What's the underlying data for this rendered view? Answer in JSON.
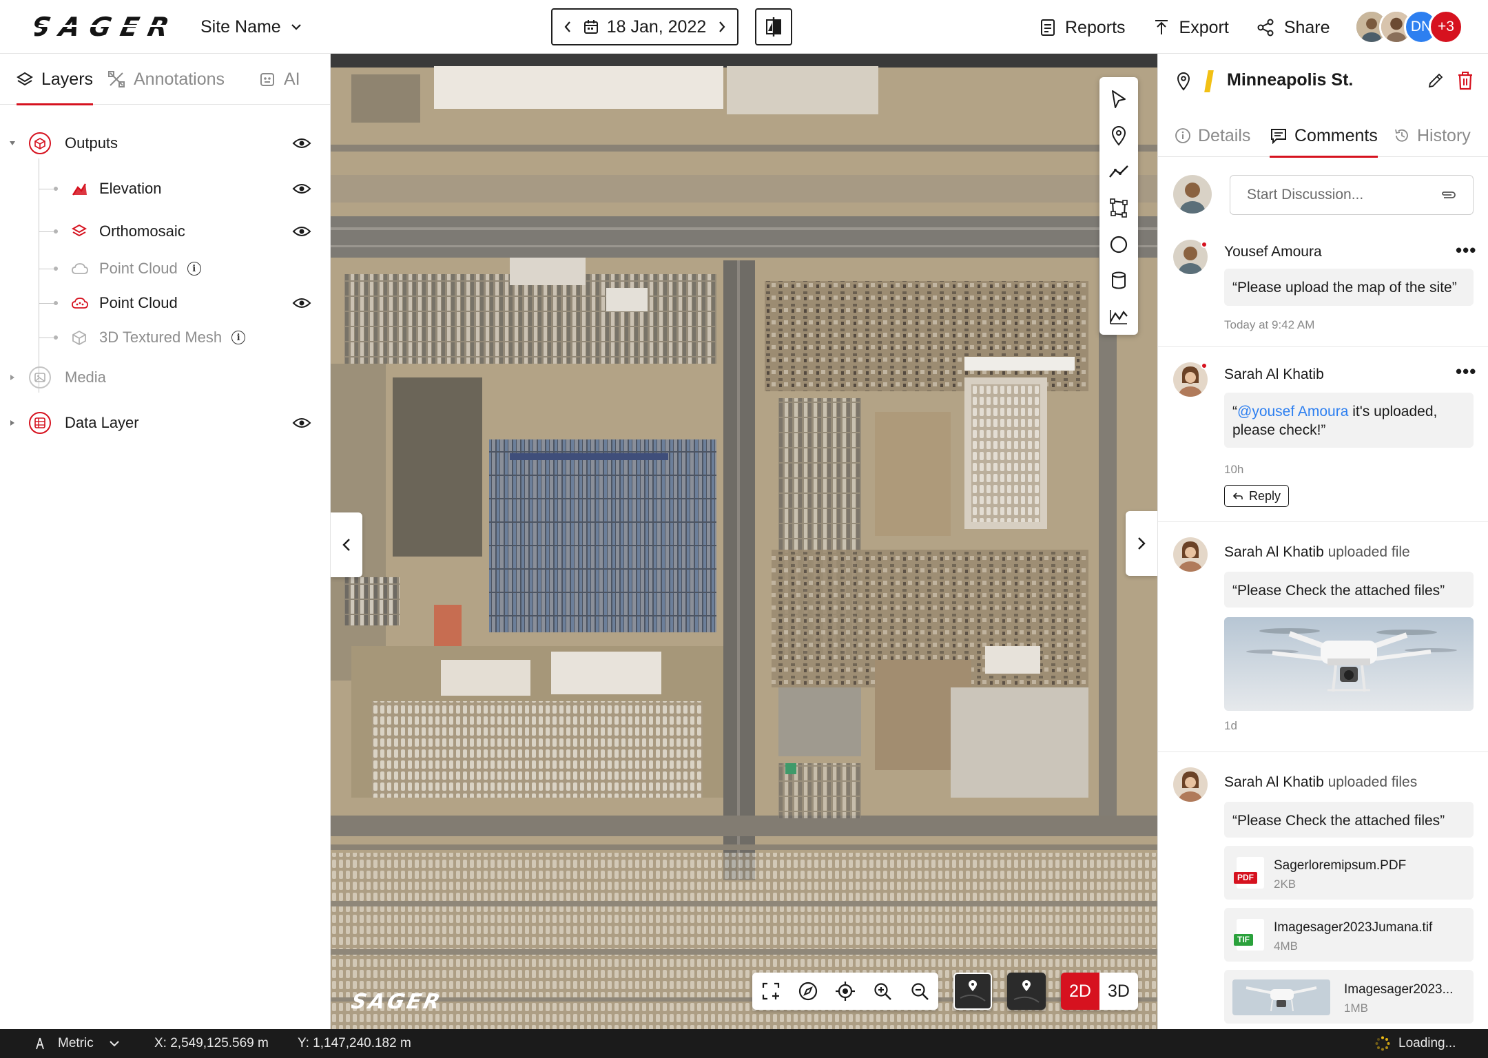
{
  "app": {
    "logo_text": "SAGER",
    "site_name": "Site Name"
  },
  "date": {
    "label": "18 Jan, 2022"
  },
  "actions": {
    "reports": "Reports",
    "export": "Export",
    "share": "Share"
  },
  "collaborators": {
    "initials": "DN",
    "more": "+3"
  },
  "left_tabs": {
    "layers": "Layers",
    "annotations": "Annotations",
    "ai": "AI"
  },
  "layers": {
    "outputs": "Outputs",
    "elevation": "Elevation",
    "orthomosaic": "Orthomosaic",
    "point_cloud_1": "Point Cloud",
    "point_cloud_2": "Point Cloud",
    "textured_mesh": "3D Textured Mesh",
    "media": "Media",
    "data_layer": "Data Layer"
  },
  "map": {
    "watermark": "SAGER",
    "view_2d": "2D",
    "view_3d": "3D",
    "active_view": "2D"
  },
  "detail": {
    "title": "Minneapolis St.",
    "tabs": {
      "details": "Details",
      "comments": "Comments",
      "history": "History"
    },
    "discussion_placeholder": "Start Discussion..."
  },
  "comments": [
    {
      "author": "Yousef Amoura",
      "action": "",
      "text": "“Please upload the map of the site”",
      "time": "Today at 9:42 AM"
    },
    {
      "author": "Sarah Al Khatib",
      "action": "",
      "mention": "@yousef Amoura",
      "text_pre": "“",
      "text_post": " it's uploaded,",
      "text_line2": "please check!”",
      "time": "10h",
      "reply": "Reply"
    },
    {
      "author": "Sarah Al Khatib",
      "action": "uploaded file",
      "text": "“Please Check the attached files”",
      "time": "1d"
    },
    {
      "author": "Sarah Al Khatib",
      "action": "uploaded files",
      "text": "“Please Check the attached files”",
      "files": [
        {
          "name": "Sagerloremipsum.PDF",
          "size": "2KB",
          "tag": "PDF"
        },
        {
          "name": "Imagesager2023Jumana.tif",
          "size": "4MB",
          "tag": "TIF"
        },
        {
          "name": "Imagesager2023...",
          "size": "1MB",
          "tag": ""
        }
      ]
    }
  ],
  "status": {
    "units": "Metric",
    "x": "X: 2,549,125.569 m",
    "y": "Y: 1,147,240.182 m",
    "loading": "Loading..."
  },
  "colors": {
    "accent": "#d6121f",
    "mention": "#2d7ff0",
    "status_bar": "#1b1b1b",
    "tif_tag": "#2aa13b"
  }
}
